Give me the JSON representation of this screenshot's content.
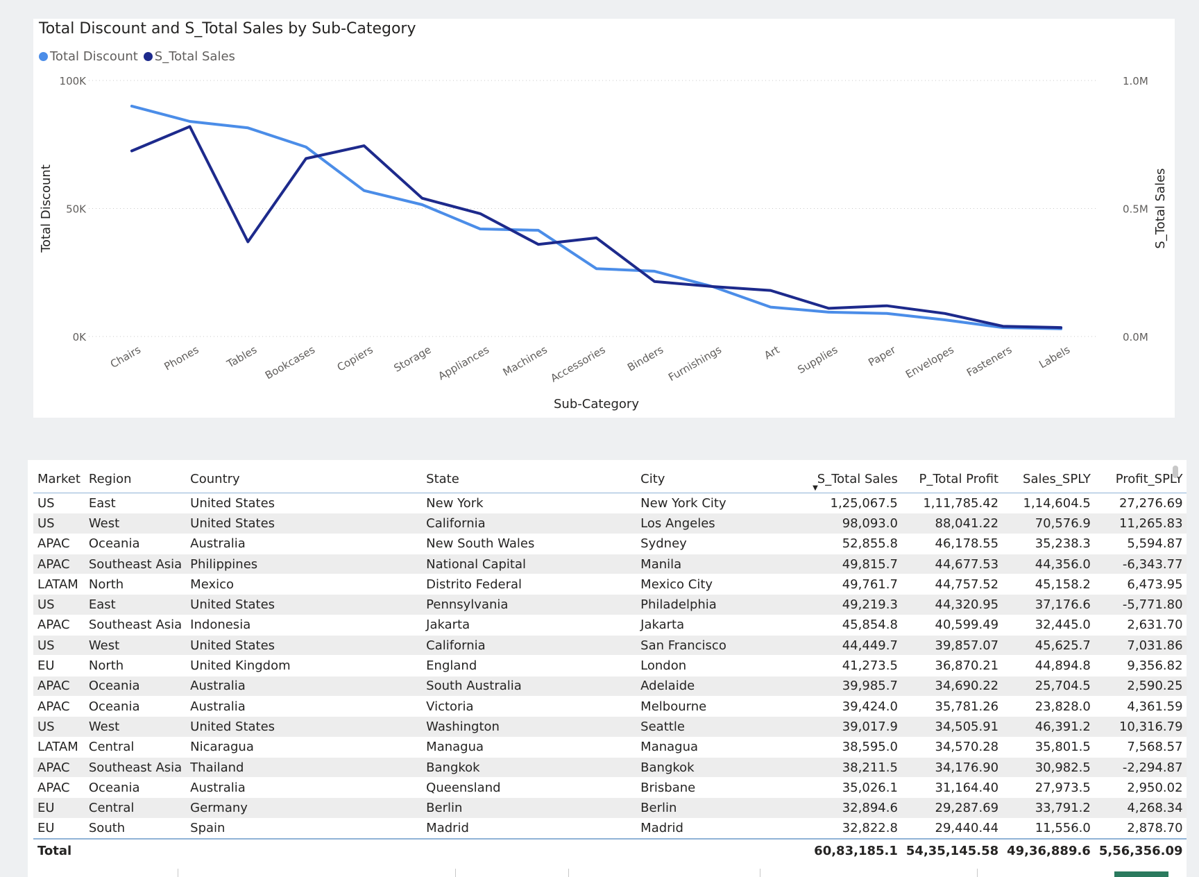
{
  "chart": {
    "title": "Total Discount and S_Total Sales by Sub-Category",
    "legend": [
      {
        "name": "Total Discount",
        "color": "#4b8de8"
      },
      {
        "name": "S_Total Sales",
        "color": "#1d2a8c"
      }
    ]
  },
  "chart_data": {
    "type": "line",
    "title": "Total Discount and S_Total Sales by Sub-Category",
    "xlabel": "Sub-Category",
    "ylabel": "Total Discount",
    "y2label": "S_Total Sales",
    "ylim": [
      0,
      100000
    ],
    "y2lim": [
      0,
      1000000
    ],
    "yticks": [
      "0K",
      "50K",
      "100K"
    ],
    "y2ticks": [
      "0.0M",
      "0.5M",
      "1.0M"
    ],
    "grid": true,
    "legend_position": "top-left",
    "categories": [
      "Chairs",
      "Phones",
      "Tables",
      "Bookcases",
      "Copiers",
      "Storage",
      "Appliances",
      "Machines",
      "Accessories",
      "Binders",
      "Furnishings",
      "Art",
      "Supplies",
      "Paper",
      "Envelopes",
      "Fasteners",
      "Labels"
    ],
    "series": [
      {
        "name": "Total Discount",
        "axis": "left",
        "color": "#4b8de8",
        "values": [
          90000,
          84000,
          81500,
          74000,
          57000,
          51500,
          42000,
          41500,
          26500,
          25500,
          19500,
          11500,
          9500,
          9000,
          6500,
          3500,
          3000
        ]
      },
      {
        "name": "S_Total Sales",
        "axis": "right",
        "color": "#1d2a8c",
        "values": [
          725000,
          820000,
          370000,
          695000,
          745000,
          540000,
          480000,
          360000,
          385000,
          215000,
          195000,
          180000,
          110000,
          120000,
          90000,
          40000,
          35000
        ]
      }
    ]
  },
  "table": {
    "columns": [
      {
        "label": "Market",
        "num": false
      },
      {
        "label": "Region",
        "num": false
      },
      {
        "label": "Country",
        "num": false
      },
      {
        "label": "State",
        "num": false
      },
      {
        "label": "City",
        "num": false
      },
      {
        "label": "S_Total Sales",
        "num": true,
        "sorted": true
      },
      {
        "label": "P_Total Profit",
        "num": true
      },
      {
        "label": "Sales_SPLY",
        "num": true
      },
      {
        "label": "Profit_SPLY",
        "num": true
      }
    ],
    "rows": [
      [
        "US",
        "East",
        "United States",
        "New York",
        "New York City",
        "1,25,067.5",
        "1,11,785.42",
        "1,14,604.5",
        "27,276.69"
      ],
      [
        "US",
        "West",
        "United States",
        "California",
        "Los Angeles",
        "98,093.0",
        "88,041.22",
        "70,576.9",
        "11,265.83"
      ],
      [
        "APAC",
        "Oceania",
        "Australia",
        "New South Wales",
        "Sydney",
        "52,855.8",
        "46,178.55",
        "35,238.3",
        "5,594.87"
      ],
      [
        "APAC",
        "Southeast Asia",
        "Philippines",
        "National Capital",
        "Manila",
        "49,815.7",
        "44,677.53",
        "44,356.0",
        "-6,343.77"
      ],
      [
        "LATAM",
        "North",
        "Mexico",
        "Distrito Federal",
        "Mexico City",
        "49,761.7",
        "44,757.52",
        "45,158.2",
        "6,473.95"
      ],
      [
        "US",
        "East",
        "United States",
        "Pennsylvania",
        "Philadelphia",
        "49,219.3",
        "44,320.95",
        "37,176.6",
        "-5,771.80"
      ],
      [
        "APAC",
        "Southeast Asia",
        "Indonesia",
        "Jakarta",
        "Jakarta",
        "45,854.8",
        "40,599.49",
        "32,445.0",
        "2,631.70"
      ],
      [
        "US",
        "West",
        "United States",
        "California",
        "San Francisco",
        "44,449.7",
        "39,857.07",
        "45,625.7",
        "7,031.86"
      ],
      [
        "EU",
        "North",
        "United Kingdom",
        "England",
        "London",
        "41,273.5",
        "36,870.21",
        "44,894.8",
        "9,356.82"
      ],
      [
        "APAC",
        "Oceania",
        "Australia",
        "South Australia",
        "Adelaide",
        "39,985.7",
        "34,690.22",
        "25,704.5",
        "2,590.25"
      ],
      [
        "APAC",
        "Oceania",
        "Australia",
        "Victoria",
        "Melbourne",
        "39,424.0",
        "35,781.26",
        "23,828.0",
        "4,361.59"
      ],
      [
        "US",
        "West",
        "United States",
        "Washington",
        "Seattle",
        "39,017.9",
        "34,505.91",
        "46,391.2",
        "10,316.79"
      ],
      [
        "LATAM",
        "Central",
        "Nicaragua",
        "Managua",
        "Managua",
        "38,595.0",
        "34,570.28",
        "35,801.5",
        "7,568.57"
      ],
      [
        "APAC",
        "Southeast Asia",
        "Thailand",
        "Bangkok",
        "Bangkok",
        "38,211.5",
        "34,176.90",
        "30,982.5",
        "-2,294.87"
      ],
      [
        "APAC",
        "Oceania",
        "Australia",
        "Queensland",
        "Brisbane",
        "35,026.1",
        "31,164.40",
        "27,973.5",
        "2,950.02"
      ],
      [
        "EU",
        "Central",
        "Germany",
        "Berlin",
        "Berlin",
        "32,894.6",
        "29,287.69",
        "33,791.2",
        "4,268.34"
      ],
      [
        "EU",
        "South",
        "Spain",
        "Madrid",
        "Madrid",
        "32,822.8",
        "29,440.44",
        "11,556.0",
        "2,878.70"
      ]
    ],
    "total": [
      "Total",
      "",
      "",
      "",
      "",
      "60,83,185.1",
      "54,35,145.58",
      "49,36,889.6",
      "5,56,356.09"
    ]
  }
}
